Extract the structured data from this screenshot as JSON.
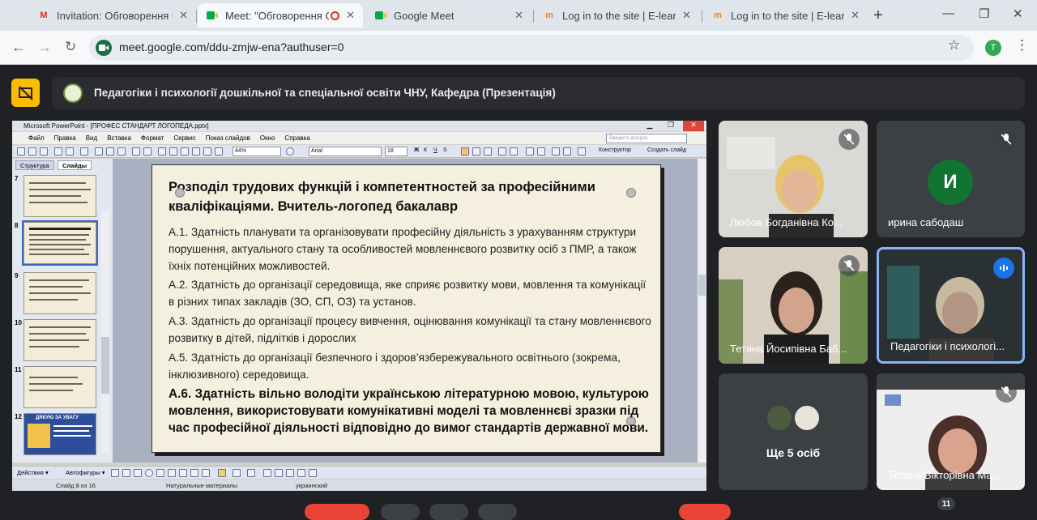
{
  "browser": {
    "tabs": [
      {
        "title": "Invitation: Обговорення ОП",
        "icon": "gmail-icon",
        "active": false
      },
      {
        "title": "Meet: \"Обговорення ОГ",
        "icon": "meet-icon",
        "active": true
      },
      {
        "title": "Google Meet",
        "icon": "meet-icon",
        "active": false
      },
      {
        "title": "Log in to the site | E-learning",
        "icon": "moodle-icon",
        "active": false
      },
      {
        "title": "Log in to the site | E-learning",
        "icon": "moodle-icon",
        "active": false
      }
    ],
    "url": "meet.google.com/ddu-zmjw-ena?authuser=0",
    "profile_initial": "T"
  },
  "meet": {
    "presentation_title": "Педагогіки і психології дошкільної та спеціальної освіти ЧНУ, Кафедра (Презентація)",
    "participants": [
      {
        "name": "Любов Богданівна Ко...",
        "muted": true
      },
      {
        "name": "ирина сабодаш",
        "initial": "И",
        "muted": true
      },
      {
        "name": "Тетяна Йосипівна Баб...",
        "muted": true
      },
      {
        "name": "Педагогіки і психологі...",
        "speaking": true
      },
      {
        "name": "Ще 5 осіб"
      },
      {
        "name": "Тетяна Вікторівна Ма...",
        "muted": true
      }
    ],
    "badge_count": "11"
  },
  "ppt": {
    "window_title": "Microsoft PowerPoint - [ПРОФЕС СТАНДАРТ ЛОГОПЕДА.pptx]",
    "menu": [
      "Файл",
      "Правка",
      "Вид",
      "Вставка",
      "Формат",
      "Сервис",
      "Показ слайдов",
      "Окно",
      "Справка"
    ],
    "search_placeholder": "Введите вопрос",
    "zoom": "44%",
    "font": "Arial",
    "font_size": "18",
    "bold": "Ж",
    "italic": "К",
    "underline": "Ч",
    "shadow": "S",
    "designer": "Конструктор",
    "new_slide": "Создать слайд",
    "left_tabs": [
      "Структура",
      "Слайды"
    ],
    "thumb_numbers": [
      "7",
      "8",
      "9",
      "10",
      "11",
      "12"
    ],
    "thumb_12_title": "ДЯКУЮ ЗА УВАГУ",
    "draw_actions": "Действия ▾",
    "autoshapes": "Автофигуры ▾",
    "status": {
      "slide": "Слайд 8 из 16",
      "design": "Натуральные материалы",
      "language": "украинский"
    },
    "slide": {
      "title": "Розподіл трудових функцій і компетентностей за професійними кваліфікаціями.   Вчитель-логопед бакалавр",
      "p1": " А.1. Здатність планувати та організовувати професійну діяльність з урахуванням структури порушення, актуального стану та особливостей мовленнєвого розвитку осіб з ПМР, а також їхніх потенційних можливостей.",
      "p2": "А.2. Здатність до організації середовища, яке сприяє розвитку мови, мовлення та комунікації в різних типах закладів (ЗО, СП, ОЗ) та установ.",
      "p3": " А.3. Здатність до організації процесу вивчення, оцінювання комунікації та стану мовленнєвого розвитку в дітей, підлітків і дорослих",
      "p4": "А.5. Здатність до організації безпечного і здоров’язбережувального освітнього (зокрема, інклюзивного) середовища.",
      "p5": "А.6. Здатність вільно володіти українською літературною мовою, культурою мовлення, використовувати комунікативні моделі та мовленнєві зразки під час професійної діяльності відповідно до вимог стандартів державної мови."
    }
  },
  "colors": {
    "meet_bg": "#202124",
    "tile_bg": "#3c4043",
    "active_tile_border": "#8ab4f8",
    "speaking_blue": "#1a73e8",
    "avatar_green": "#137333",
    "warn_yellow": "#fbbc04"
  }
}
